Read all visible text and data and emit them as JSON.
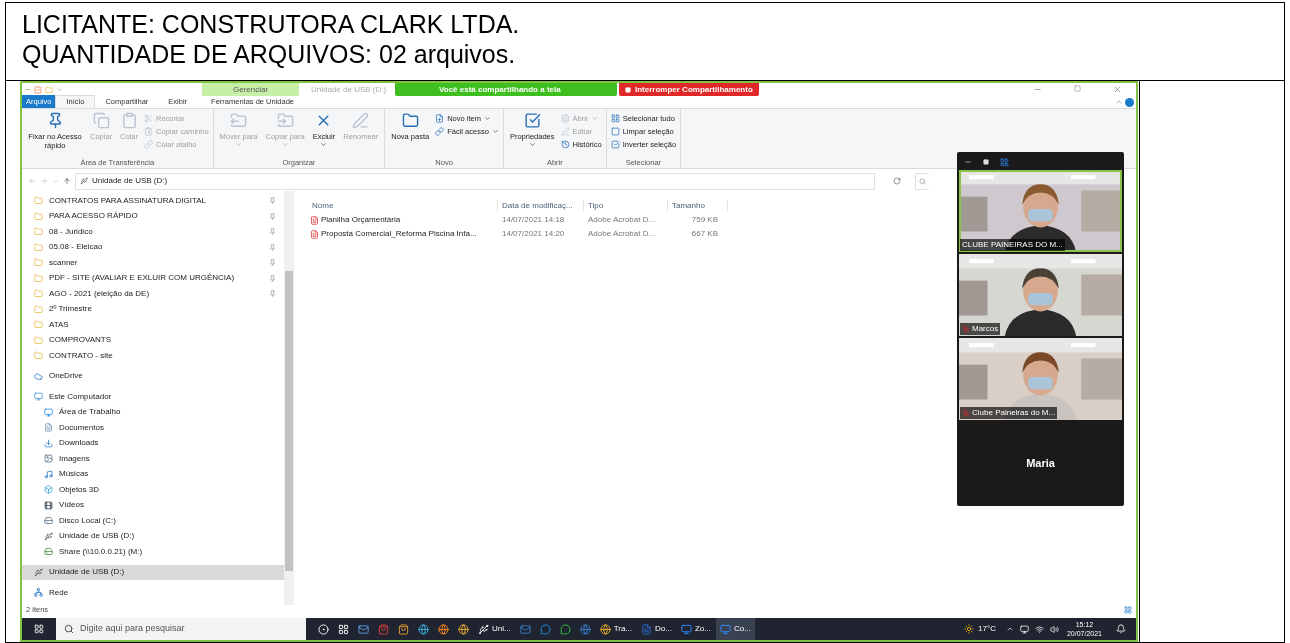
{
  "header": {
    "lines": [
      "LICITANTE: CONSTRUTORA CLARK LTDA.",
      "QUANTIDADE DE ARQUIVOS: 02 arquivos."
    ]
  },
  "explorer": {
    "context_tab": "Gerenciar",
    "title": "Unidade de USB (D:)",
    "share_banner": {
      "status": "Você está compartilhando a tela",
      "stop": "Interromper Compartilhamento"
    },
    "tabs": [
      {
        "label": "Arquivo",
        "kind": "file",
        "selected": false
      },
      {
        "label": "Início",
        "kind": "tab",
        "selected": true
      },
      {
        "label": "Compartilhar",
        "kind": "tab",
        "selected": false
      },
      {
        "label": "Exibir",
        "kind": "tab",
        "selected": false
      },
      {
        "label": "Ferramentas de Unidade",
        "kind": "context",
        "selected": false
      }
    ],
    "ribbon_groups": [
      {
        "label": "Área de Transferência",
        "items": [
          {
            "label": "Fixar no Acesso rápido",
            "kind": "large",
            "disabled": false,
            "menu": false
          },
          {
            "label": "Copiar",
            "kind": "large",
            "disabled": true,
            "menu": false
          },
          {
            "label": "Colar",
            "kind": "large",
            "disabled": true,
            "menu": false
          },
          {
            "label": "Recortar",
            "kind": "small",
            "disabled": true,
            "menu": false
          },
          {
            "label": "Copiar caminho",
            "kind": "small",
            "disabled": true,
            "menu": false
          },
          {
            "label": "Colar atalho",
            "kind": "small",
            "disabled": true,
            "menu": false
          }
        ]
      },
      {
        "label": "Organizar",
        "items": [
          {
            "label": "Mover para",
            "kind": "large",
            "disabled": true,
            "menu": true
          },
          {
            "label": "Copiar para",
            "kind": "large",
            "disabled": true,
            "menu": true
          },
          {
            "label": "Excluir",
            "kind": "large",
            "disabled": false,
            "menu": true
          },
          {
            "label": "Renomear",
            "kind": "large",
            "disabled": true,
            "menu": false
          }
        ]
      },
      {
        "label": "Novo",
        "items": [
          {
            "label": "Nova pasta",
            "kind": "large",
            "disabled": false,
            "menu": false
          },
          {
            "label": "Novo item",
            "kind": "small",
            "disabled": false,
            "menu": true
          },
          {
            "label": "Fácil acesso",
            "kind": "small",
            "disabled": false,
            "menu": true
          }
        ]
      },
      {
        "label": "Abrir",
        "items": [
          {
            "label": "Propriedades",
            "kind": "large",
            "disabled": false,
            "menu": true
          },
          {
            "label": "Abrir",
            "kind": "small",
            "disabled": true,
            "menu": true
          },
          {
            "label": "Editar",
            "kind": "small",
            "disabled": true,
            "menu": false
          },
          {
            "label": "Histórico",
            "kind": "small",
            "disabled": false,
            "menu": false
          }
        ]
      },
      {
        "label": "Selecionar",
        "items": [
          {
            "label": "Selecionar tudo",
            "kind": "small",
            "disabled": false,
            "menu": false
          },
          {
            "label": "Limpar seleção",
            "kind": "small",
            "disabled": false,
            "menu": false
          },
          {
            "label": "Inverter seleção",
            "kind": "small",
            "disabled": false,
            "menu": false
          }
        ]
      }
    ],
    "address": "Unidade de USB (D:)",
    "nav": [
      {
        "label": "CONTRATOS PARA ASSINATURA DIGITAL",
        "kind": "folder",
        "pinned": true,
        "selected": false
      },
      {
        "label": "PARA ACESSO RÁPIDO",
        "kind": "folder",
        "pinned": true,
        "selected": false
      },
      {
        "label": "08 - Juridico",
        "kind": "folder",
        "pinned": true,
        "selected": false
      },
      {
        "label": "05.08 - Eleicao",
        "kind": "folder",
        "pinned": true,
        "selected": false
      },
      {
        "label": "scanner",
        "kind": "folder",
        "pinned": true,
        "selected": false
      },
      {
        "label": "PDF - SITE (AVALIAR E EXLUIR COM URGÊNCIA)",
        "kind": "folder",
        "pinned": true,
        "selected": false
      },
      {
        "label": "AGO - 2021 (eleição da DE)",
        "kind": "folder",
        "pinned": true,
        "selected": false
      },
      {
        "label": "2º Trimestre",
        "kind": "folder",
        "pinned": false,
        "selected": false
      },
      {
        "label": "ATAS",
        "kind": "folder",
        "pinned": false,
        "selected": false
      },
      {
        "label": "COMPROVANTS",
        "kind": "folder",
        "pinned": false,
        "selected": false
      },
      {
        "label": "CONTRATO - site",
        "kind": "folder",
        "pinned": false,
        "selected": false
      },
      {
        "label": "OneDrive",
        "kind": "cloud",
        "pinned": false,
        "selected": false
      },
      {
        "label": "Este Computador",
        "kind": "pc",
        "pinned": false,
        "selected": false,
        "children": [
          {
            "label": "Área de Trabalho",
            "kind": "desktop",
            "pinned": false,
            "selected": false
          },
          {
            "label": "Documentos",
            "kind": "docs",
            "pinned": false,
            "selected": false
          },
          {
            "label": "Downloads",
            "kind": "download",
            "pinned": false,
            "selected": false
          },
          {
            "label": "Imagens",
            "kind": "images",
            "pinned": false,
            "selected": false
          },
          {
            "label": "Músicas",
            "kind": "music",
            "pinned": false,
            "selected": false
          },
          {
            "label": "Objetos 3D",
            "kind": "cube",
            "pinned": false,
            "selected": false
          },
          {
            "label": "Vídeos",
            "kind": "video",
            "pinned": false,
            "selected": false
          },
          {
            "label": "Disco Local (C:)",
            "kind": "disk",
            "pinned": false,
            "selected": false
          },
          {
            "label": "Unidade de USB (D:)",
            "kind": "usb",
            "pinned": false,
            "selected": false
          },
          {
            "label": "Share (\\\\10.0.0.21) (M:)",
            "kind": "netdrive",
            "pinned": false,
            "selected": false
          }
        ]
      },
      {
        "label": "Unidade de USB (D:)",
        "kind": "usb",
        "pinned": false,
        "selected": true
      },
      {
        "label": "Rede",
        "kind": "network",
        "pinned": false,
        "selected": false
      }
    ],
    "columns": [
      "Nome",
      "Data de modificaç...",
      "Tipo",
      "Tamanho"
    ],
    "rows": [
      [
        "Planilha Orçamentária",
        "14/07/2021 14:18",
        "Adobe Acrobat D...",
        "759 KB"
      ],
      [
        "Proposta Comercial_Reforma Piscina Infa...",
        "14/07/2021 14:20",
        "Adobe Acrobat D...",
        "667 KB"
      ]
    ],
    "status": "2 itens"
  },
  "video_panel": {
    "tiles": [
      {
        "kind": "video",
        "name": "CLUBE PAINEIRAS DO M...",
        "muted": false,
        "speaking": true
      },
      {
        "kind": "video",
        "name": "Marcos",
        "muted": true,
        "speaking": false
      },
      {
        "kind": "video",
        "name": "Clube Paineiras do M...",
        "muted": true,
        "speaking": false
      },
      {
        "kind": "name",
        "name": "Maria"
      }
    ]
  },
  "taskbar": {
    "search_placeholder": "Digite aqui para pesquisar",
    "apps": [
      {
        "selected": false
      },
      {
        "selected": false
      },
      {
        "selected": false
      },
      {
        "selected": false
      },
      {
        "selected": false
      },
      {
        "selected": false
      },
      {
        "selected": false
      },
      {
        "selected": false
      },
      {
        "label": "Uni...",
        "selected": false
      },
      {
        "selected": false
      },
      {
        "selected": false
      },
      {
        "selected": false
      },
      {
        "selected": false
      },
      {
        "label": "Tra...",
        "selected": false
      },
      {
        "label": "Do...",
        "selected": false
      },
      {
        "label": "Zo...",
        "selected": false
      },
      {
        "label": "Co...",
        "selected": true
      }
    ],
    "weather": "17°C",
    "time": "15:12",
    "date": "20/07/2021"
  }
}
